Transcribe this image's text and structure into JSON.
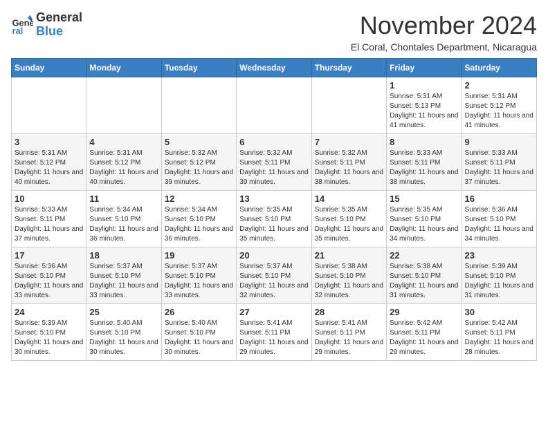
{
  "logo": {
    "general": "General",
    "blue": "Blue"
  },
  "header": {
    "month": "November 2024",
    "location": "El Coral, Chontales Department, Nicaragua"
  },
  "weekdays": [
    "Sunday",
    "Monday",
    "Tuesday",
    "Wednesday",
    "Thursday",
    "Friday",
    "Saturday"
  ],
  "weeks": [
    [
      {
        "day": "",
        "info": ""
      },
      {
        "day": "",
        "info": ""
      },
      {
        "day": "",
        "info": ""
      },
      {
        "day": "",
        "info": ""
      },
      {
        "day": "",
        "info": ""
      },
      {
        "day": "1",
        "info": "Sunrise: 5:31 AM\nSunset: 5:13 PM\nDaylight: 11 hours and 41 minutes."
      },
      {
        "day": "2",
        "info": "Sunrise: 5:31 AM\nSunset: 5:12 PM\nDaylight: 11 hours and 41 minutes."
      }
    ],
    [
      {
        "day": "3",
        "info": "Sunrise: 5:31 AM\nSunset: 5:12 PM\nDaylight: 11 hours and 40 minutes."
      },
      {
        "day": "4",
        "info": "Sunrise: 5:31 AM\nSunset: 5:12 PM\nDaylight: 11 hours and 40 minutes."
      },
      {
        "day": "5",
        "info": "Sunrise: 5:32 AM\nSunset: 5:12 PM\nDaylight: 11 hours and 39 minutes."
      },
      {
        "day": "6",
        "info": "Sunrise: 5:32 AM\nSunset: 5:11 PM\nDaylight: 11 hours and 39 minutes."
      },
      {
        "day": "7",
        "info": "Sunrise: 5:32 AM\nSunset: 5:11 PM\nDaylight: 11 hours and 38 minutes."
      },
      {
        "day": "8",
        "info": "Sunrise: 5:33 AM\nSunset: 5:11 PM\nDaylight: 11 hours and 38 minutes."
      },
      {
        "day": "9",
        "info": "Sunrise: 5:33 AM\nSunset: 5:11 PM\nDaylight: 11 hours and 37 minutes."
      }
    ],
    [
      {
        "day": "10",
        "info": "Sunrise: 5:33 AM\nSunset: 5:11 PM\nDaylight: 11 hours and 37 minutes."
      },
      {
        "day": "11",
        "info": "Sunrise: 5:34 AM\nSunset: 5:10 PM\nDaylight: 11 hours and 36 minutes."
      },
      {
        "day": "12",
        "info": "Sunrise: 5:34 AM\nSunset: 5:10 PM\nDaylight: 11 hours and 36 minutes."
      },
      {
        "day": "13",
        "info": "Sunrise: 5:35 AM\nSunset: 5:10 PM\nDaylight: 11 hours and 35 minutes."
      },
      {
        "day": "14",
        "info": "Sunrise: 5:35 AM\nSunset: 5:10 PM\nDaylight: 11 hours and 35 minutes."
      },
      {
        "day": "15",
        "info": "Sunrise: 5:35 AM\nSunset: 5:10 PM\nDaylight: 11 hours and 34 minutes."
      },
      {
        "day": "16",
        "info": "Sunrise: 5:36 AM\nSunset: 5:10 PM\nDaylight: 11 hours and 34 minutes."
      }
    ],
    [
      {
        "day": "17",
        "info": "Sunrise: 5:36 AM\nSunset: 5:10 PM\nDaylight: 11 hours and 33 minutes."
      },
      {
        "day": "18",
        "info": "Sunrise: 5:37 AM\nSunset: 5:10 PM\nDaylight: 11 hours and 33 minutes."
      },
      {
        "day": "19",
        "info": "Sunrise: 5:37 AM\nSunset: 5:10 PM\nDaylight: 11 hours and 33 minutes."
      },
      {
        "day": "20",
        "info": "Sunrise: 5:37 AM\nSunset: 5:10 PM\nDaylight: 11 hours and 32 minutes."
      },
      {
        "day": "21",
        "info": "Sunrise: 5:38 AM\nSunset: 5:10 PM\nDaylight: 11 hours and 32 minutes."
      },
      {
        "day": "22",
        "info": "Sunrise: 5:38 AM\nSunset: 5:10 PM\nDaylight: 11 hours and 31 minutes."
      },
      {
        "day": "23",
        "info": "Sunrise: 5:39 AM\nSunset: 5:10 PM\nDaylight: 11 hours and 31 minutes."
      }
    ],
    [
      {
        "day": "24",
        "info": "Sunrise: 5:39 AM\nSunset: 5:10 PM\nDaylight: 11 hours and 30 minutes."
      },
      {
        "day": "25",
        "info": "Sunrise: 5:40 AM\nSunset: 5:10 PM\nDaylight: 11 hours and 30 minutes."
      },
      {
        "day": "26",
        "info": "Sunrise: 5:40 AM\nSunset: 5:10 PM\nDaylight: 11 hours and 30 minutes."
      },
      {
        "day": "27",
        "info": "Sunrise: 5:41 AM\nSunset: 5:11 PM\nDaylight: 11 hours and 29 minutes."
      },
      {
        "day": "28",
        "info": "Sunrise: 5:41 AM\nSunset: 5:11 PM\nDaylight: 11 hours and 29 minutes."
      },
      {
        "day": "29",
        "info": "Sunrise: 5:42 AM\nSunset: 5:11 PM\nDaylight: 11 hours and 29 minutes."
      },
      {
        "day": "30",
        "info": "Sunrise: 5:42 AM\nSunset: 5:11 PM\nDaylight: 11 hours and 28 minutes."
      }
    ]
  ]
}
